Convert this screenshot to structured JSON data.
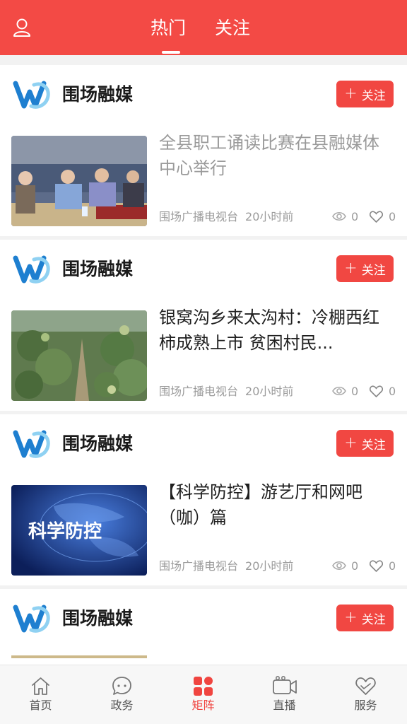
{
  "header": {
    "tabs": [
      {
        "label": "热门",
        "active": true
      },
      {
        "label": "关注",
        "active": false
      }
    ]
  },
  "colors": {
    "brand": "#f34a45",
    "follow_button": "#f14742"
  },
  "feed": [
    {
      "source": "围场融媒",
      "follow_label": "关注",
      "title": "全县职工诵读比赛在县融媒体中心举行",
      "title_style": "read",
      "publisher": "围场广播电视台",
      "time": "20小时前",
      "views": "0",
      "likes": "0"
    },
    {
      "source": "围场融媒",
      "follow_label": "关注",
      "title": "银窝沟乡来太沟村：冷棚西红柿成熟上市 贫困村民...",
      "title_style": "unread",
      "publisher": "围场广播电视台",
      "time": "20小时前",
      "views": "0",
      "likes": "0"
    },
    {
      "source": "围场融媒",
      "follow_label": "关注",
      "title": "【科学防控】游艺厅和网吧（咖）篇",
      "title_style": "unread",
      "thumb_text": "科学防控",
      "publisher": "围场广播电视台",
      "time": "20小时前",
      "views": "0",
      "likes": "0"
    },
    {
      "source": "围场融媒",
      "follow_label": "关注"
    }
  ],
  "tabbar": [
    {
      "label": "首页",
      "icon": "home-icon",
      "active": false
    },
    {
      "label": "政务",
      "icon": "chat-bubble-icon",
      "active": false
    },
    {
      "label": "矩阵",
      "icon": "grid-icon",
      "active": true
    },
    {
      "label": "直播",
      "icon": "video-camera-icon",
      "active": false
    },
    {
      "label": "服务",
      "icon": "heart-service-icon",
      "active": false
    }
  ]
}
